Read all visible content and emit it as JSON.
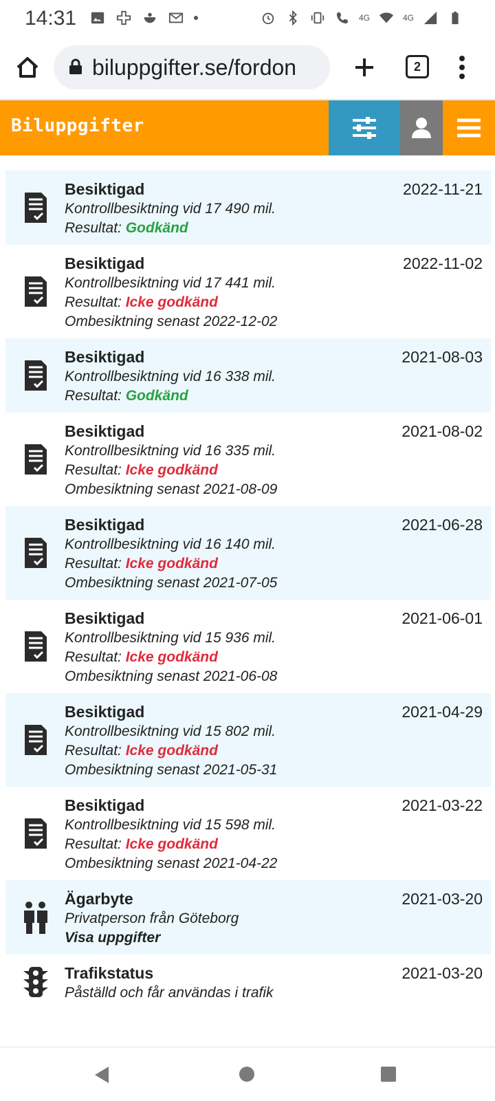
{
  "status_bar": {
    "time": "14:31",
    "network_labels": [
      "4G",
      "4G"
    ]
  },
  "browser": {
    "url": "biluppgifter.se/fordon",
    "tab_count": "2"
  },
  "site": {
    "brand": "Biluppgifter",
    "accent": "#ff9a00",
    "filter_color": "#3399c2"
  },
  "events": [
    {
      "title": "Besiktigad",
      "date": "2022-11-21",
      "line1": "Kontrollbesiktning vid 17 490 mil.",
      "result_prefix": "Resultat: ",
      "result": "Godkänd",
      "status": "ok",
      "line3": ""
    },
    {
      "title": "Besiktigad",
      "date": "2022-11-02",
      "line1": "Kontrollbesiktning vid 17 441 mil.",
      "result_prefix": "Resultat: ",
      "result": "Icke godkänd",
      "status": "fail",
      "line3": "Ombesiktning senast 2022-12-02"
    },
    {
      "title": "Besiktigad",
      "date": "2021-08-03",
      "line1": "Kontrollbesiktning vid 16 338 mil.",
      "result_prefix": "Resultat: ",
      "result": "Godkänd",
      "status": "ok",
      "line3": ""
    },
    {
      "title": "Besiktigad",
      "date": "2021-08-02",
      "line1": "Kontrollbesiktning vid 16 335 mil.",
      "result_prefix": "Resultat: ",
      "result": "Icke godkänd",
      "status": "fail",
      "line3": "Ombesiktning senast 2021-08-09"
    },
    {
      "title": "Besiktigad",
      "date": "2021-06-28",
      "line1": "Kontrollbesiktning vid 16 140 mil.",
      "result_prefix": "Resultat: ",
      "result": "Icke godkänd",
      "status": "fail",
      "line3": "Ombesiktning senast 2021-07-05"
    },
    {
      "title": "Besiktigad",
      "date": "2021-06-01",
      "line1": "Kontrollbesiktning vid 15 936 mil.",
      "result_prefix": "Resultat: ",
      "result": "Icke godkänd",
      "status": "fail",
      "line3": "Ombesiktning senast 2021-06-08"
    },
    {
      "title": "Besiktigad",
      "date": "2021-04-29",
      "line1": "Kontrollbesiktning vid 15 802 mil.",
      "result_prefix": "Resultat: ",
      "result": "Icke godkänd",
      "status": "fail",
      "line3": "Ombesiktning senast 2021-05-31"
    },
    {
      "title": "Besiktigad",
      "date": "2021-03-22",
      "line1": "Kontrollbesiktning vid 15 598 mil.",
      "result_prefix": "Resultat: ",
      "result": "Icke godkänd",
      "status": "fail",
      "line3": "Ombesiktning senast 2021-04-22"
    }
  ],
  "owner_change": {
    "title": "Ägarbyte",
    "date": "2021-03-20",
    "line1": "Privatperson från Göteborg",
    "link": "Visa uppgifter"
  },
  "traffic_status": {
    "title": "Trafikstatus",
    "date": "2021-03-20",
    "line1": "Påställd och får användas i trafik"
  }
}
